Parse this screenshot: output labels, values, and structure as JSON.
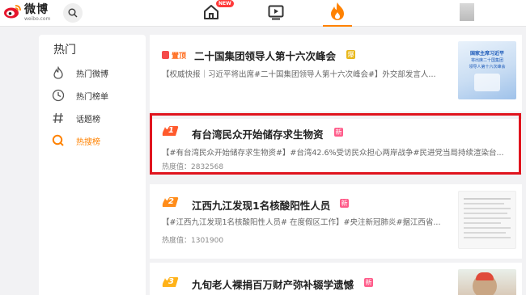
{
  "header": {
    "logo_cn": "微博",
    "logo_en": "weibo.com",
    "nav_new_badge": "NEW"
  },
  "sidebar": {
    "title": "热门",
    "items": [
      {
        "label": "热门微博",
        "icon": "fire-outline-icon",
        "active": false
      },
      {
        "label": "热门榜单",
        "icon": "clock-icon",
        "active": false
      },
      {
        "label": "话题榜",
        "icon": "hashtag-icon",
        "active": false
      },
      {
        "label": "热搜榜",
        "icon": "search-magnifier-icon",
        "active": true
      }
    ]
  },
  "cards": [
    {
      "rank_label": "置顶",
      "title": "二十国集团领导人第十六次峰会",
      "badge": "爆",
      "summary": "【权威快报｜习近平将出席#二十国集团领导人第十六次峰会#】外交部发言人...",
      "thumb_lines": [
        "国家主席习近平",
        "将出席二十国集团",
        "领导人第十六次峰会"
      ]
    },
    {
      "rank": "1",
      "title": "有台湾民众开始储存求生物资",
      "badge": "新",
      "summary": "【#有台湾民众开始储存求生物资#】#台湾42.6%受访民众担心两岸战争#民进党当局持续渲染台...",
      "heat": "热度值：2832568"
    },
    {
      "rank": "2",
      "title": "江西九江发现1名核酸阳性人员",
      "badge": "新",
      "summary": "【#江西九江发现1名核酸阳性人员# 在度假区工作】#央注新冠肺炎#据江西省...",
      "heat": "热度值：1301900"
    },
    {
      "rank": "3",
      "title": "九旬老人裸捐百万财产弥补辍学遗憾",
      "badge": "新"
    }
  ],
  "colors": {
    "accent": "#ff8200",
    "highlight_border": "#e0141e",
    "new_badge": "#ff5c8a",
    "rank1": "#ff5a2c",
    "rank2": "#ff8c1a",
    "rank3": "#ffb219"
  }
}
